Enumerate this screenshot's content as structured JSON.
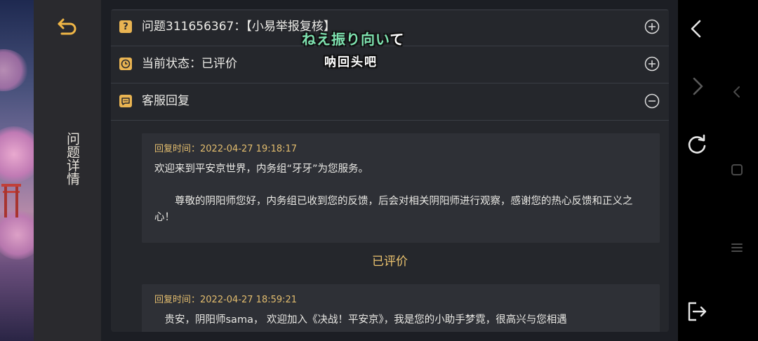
{
  "side_panel": {
    "title": "问题详情",
    "back_icon": "back-return-icon"
  },
  "sections": [
    {
      "icon": "question-icon",
      "label": "问题311656367：【小易举报复核】",
      "expanded": false,
      "toggle_icon": "plus-circle-icon"
    },
    {
      "icon": "clock-icon",
      "label": "当前状态：已评价",
      "expanded": false,
      "toggle_icon": "plus-circle-icon"
    },
    {
      "icon": "chat-bubble-icon",
      "label": "客服回复",
      "expanded": true,
      "toggle_icon": "minus-circle-icon"
    }
  ],
  "replies": [
    {
      "time": "回复时间：2022-04-27 19:18:17",
      "line1": "欢迎来到平安京世界，内务组“牙牙”为您服务。",
      "line2": "　　尊敬的阴阳师您好，内务组已收到您的反馈，后会对相关阴阳师进行观察，感谢您的热心反馈和正义之心！"
    },
    {
      "time": "回复时间：2022-04-27 18:59:21",
      "line1": "　贵安，阴阳师sama， 欢迎加入《决战！平安京》，我是您的小助手梦霓，很高兴与您相遇"
    }
  ],
  "rated_label": "已评价",
  "stickers": {
    "line1_kana": "ねえ振り向い",
    "line1_end": "て",
    "line2": "呐回头吧"
  },
  "browser_bar": {
    "icons": [
      "chevron-left-icon",
      "chevron-right-icon",
      "refresh-icon",
      "exit-icon"
    ]
  },
  "system_nav": {
    "icons": [
      "back-triangle-icon",
      "home-square-icon",
      "menu-lines-icon"
    ]
  },
  "colors": {
    "accent_gold": "#e9b452",
    "rated_gold": "#ebc36f",
    "panel_bg": "#25272c",
    "reply_bg": "#2e3036"
  }
}
